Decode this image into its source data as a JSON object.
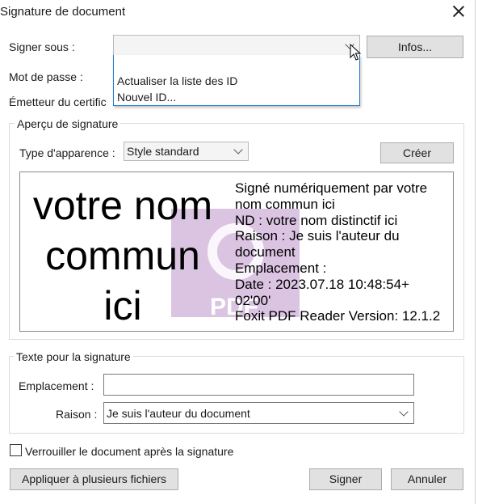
{
  "dialog": {
    "title": "Signature de document"
  },
  "sign_under": {
    "label": "Signer sous :",
    "value": "",
    "info_button": "Infos..."
  },
  "dropdown_options": [
    "Actualiser la liste des ID",
    "Nouvel ID..."
  ],
  "password": {
    "label": "Mot de passe :"
  },
  "issuer": {
    "label": "Émetteur du certific"
  },
  "preview_group": {
    "title": "Aperçu de signature",
    "appearance_label": "Type d'apparence :",
    "appearance_value": "Style standard",
    "create_button": "Créer"
  },
  "preview": {
    "name_lines": [
      "votre nom",
      "commun",
      "ici"
    ],
    "info_lines": [
      "Signé numériquement par votre",
      "nom commun ici",
      "ND : votre nom distinctif ici",
      "Raison : Je suis l'auteur du",
      "document",
      "Emplacement :",
      "Date : 2023.07.18 10:48:54+",
      "02'00'",
      "Foxit PDF Reader Version: 12.1.2"
    ],
    "logo_text": "PDF"
  },
  "text_group": {
    "title": "Texte pour la signature",
    "location_label": "Emplacement :",
    "location_value": "",
    "reason_label": "Raison :",
    "reason_value": "Je suis l'auteur du document"
  },
  "lock": {
    "label": "Verrouiller le document après la signature",
    "checked": false
  },
  "buttons": {
    "apply_multiple": "Appliquer à plusieurs fichiers",
    "sign": "Signer",
    "cancel": "Annuler"
  },
  "colors": {
    "dropdown_border": "#1f7ad1",
    "logo_background": "#dbc3e2",
    "button_face": "#e1e1e1"
  }
}
